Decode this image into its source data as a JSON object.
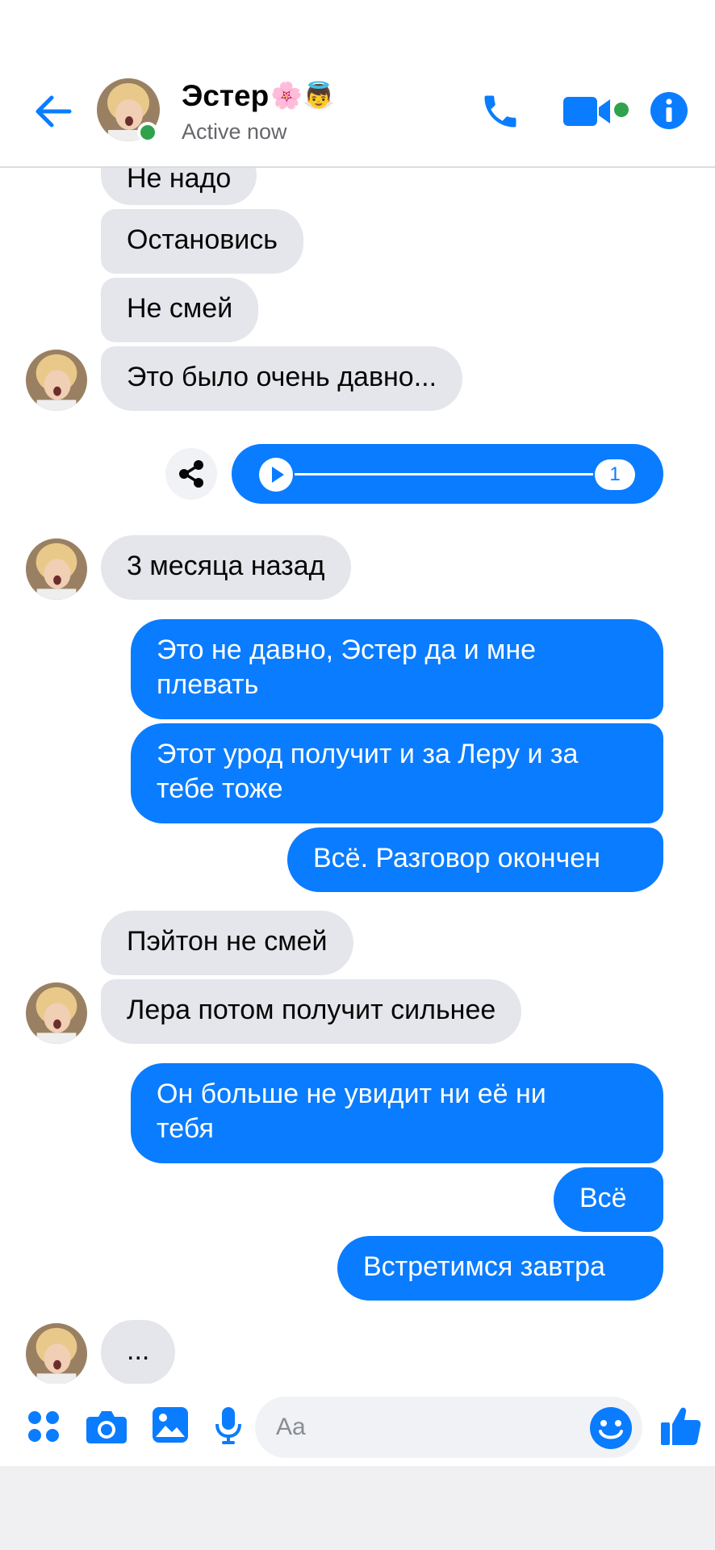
{
  "header": {
    "contact_name": "Эстер",
    "name_emojis": "🌸👼",
    "status": "Active now",
    "back_icon": "back-arrow-icon",
    "call_icon": "phone-icon",
    "video_icon": "video-camera-icon",
    "info_icon": "info-icon"
  },
  "colors": {
    "accent": "#0a7cff",
    "incoming_bubble": "#e4e6eb",
    "online": "#31a24c"
  },
  "messages": [
    {
      "side": "in",
      "text": "Не надо"
    },
    {
      "side": "in",
      "text": "Остановись"
    },
    {
      "side": "in",
      "text": "Не смей"
    },
    {
      "side": "in",
      "text": "Это было очень давно..."
    },
    {
      "side": "out",
      "type": "voice",
      "count": "1"
    },
    {
      "side": "in",
      "text": "3 месяца назад"
    },
    {
      "side": "out",
      "lines": [
        "Это не давно, Эстер да и мне",
        "плевать"
      ]
    },
    {
      "side": "out",
      "lines": [
        "Этот урод получит и за Леру и за",
        "тебе тоже"
      ]
    },
    {
      "side": "out",
      "text": "Всё. Разговор окончен"
    },
    {
      "side": "in",
      "text": "Пэйтон не смей"
    },
    {
      "side": "in",
      "text": "Лера потом получит сильнее"
    },
    {
      "side": "out",
      "lines": [
        "Он больше не увидит ни её ни",
        "тебя"
      ]
    },
    {
      "side": "out",
      "text": "Всё"
    },
    {
      "side": "out",
      "text": "Встретимся завтра"
    },
    {
      "side": "in",
      "text": "..."
    }
  ],
  "composer": {
    "placeholder": "Aa",
    "icons": [
      "apps-icon",
      "camera-icon",
      "gallery-icon",
      "microphone-icon",
      "emoji-icon",
      "thumbs-up-icon"
    ]
  }
}
